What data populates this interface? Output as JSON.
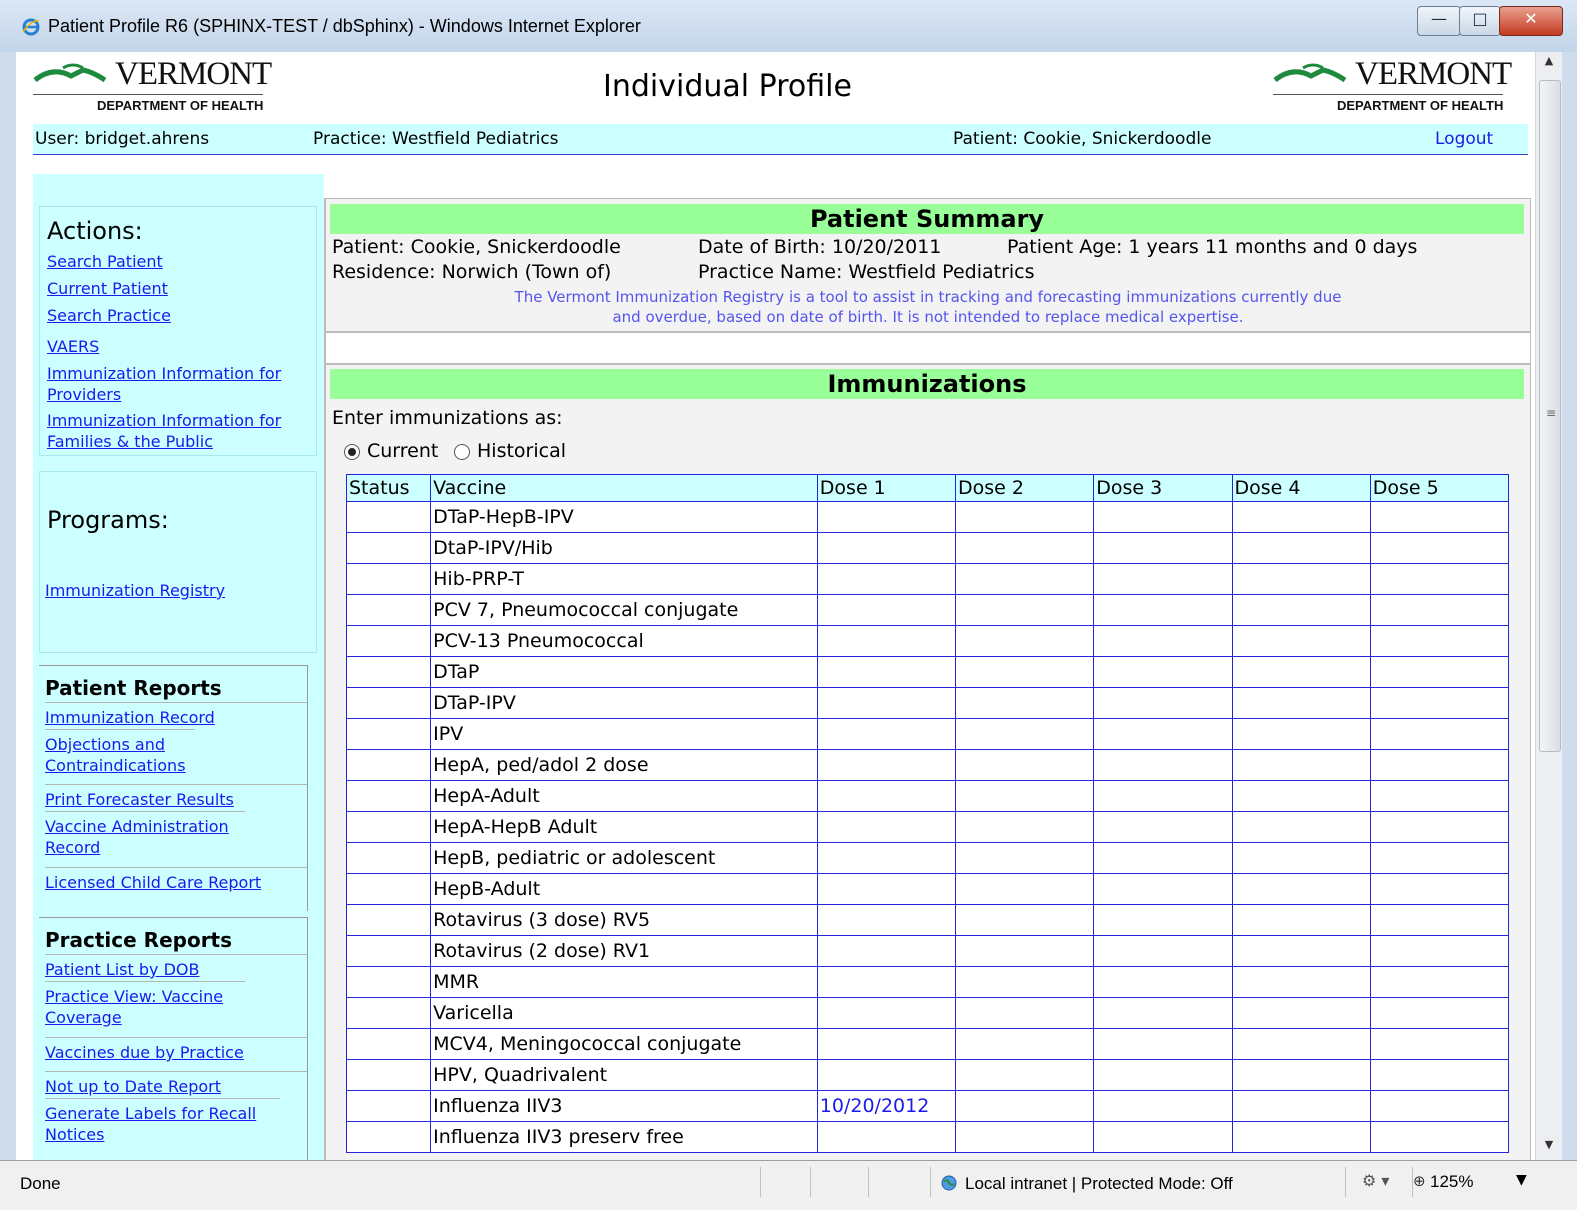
{
  "window": {
    "title": "Patient Profile R6 (SPHINX-TEST / dbSphinx) - Windows Internet Explorer",
    "minimize_icon": "minimize-icon",
    "maximize_icon": "maximize-icon",
    "close_icon": "close-icon"
  },
  "header": {
    "logo_left": {
      "word": "VERMONT",
      "dept": "DEPARTMENT OF HEALTH"
    },
    "title": "Individual Profile",
    "logo_right": {
      "word": "VERMONT",
      "dept": "DEPARTMENT OF HEALTH"
    }
  },
  "userbar": {
    "user": "User: bridget.ahrens",
    "practice": "Practice: Westfield Pediatrics",
    "patient": "Patient: Cookie, Snickerdoodle",
    "logout": "Logout"
  },
  "sidebar": {
    "actions_heading": "Actions:",
    "actions": [
      "Search Patient",
      "Current Patient",
      "Search Practice",
      "VAERS",
      "Immunization Information for Providers",
      "Immunization Information for Families & the Public"
    ],
    "programs_heading": "Programs:",
    "programs": [
      "Immunization Registry"
    ],
    "patient_reports_title": "Patient Reports",
    "patient_reports": [
      "Immunization Record",
      "Objections and Contraindications",
      "Print Forecaster Results",
      "Vaccine Administration Record",
      "Licensed Child Care Report"
    ],
    "practice_reports_title": "Practice Reports",
    "practice_reports": [
      "Patient List by DOB",
      "Practice View: Vaccine Coverage",
      "Vaccines due by Practice",
      "Not up to Date Report",
      "Generate Labels for Recall Notices"
    ]
  },
  "summary": {
    "heading": "Patient Summary",
    "patient": "Patient: Cookie, Snickerdoodle",
    "dob": "Date of Birth: 10/20/2011",
    "age": "Patient Age: 1 years 11 months and 0 days",
    "residence": "Residence: Norwich (Town of)",
    "practice_name": "Practice Name: Westfield Pediatrics",
    "disclaimer_line1": "The Vermont Immunization Registry is a tool to assist in tracking and forecasting immunizations currently due",
    "disclaimer_line2": "and overdue, based on date of birth. It is not intended to replace medical expertise."
  },
  "immunizations": {
    "heading": "Immunizations",
    "enter_label": "Enter immunizations as:",
    "mode_options": [
      "Current",
      "Historical"
    ],
    "selected_mode": "Current",
    "columns": [
      "Status",
      "Vaccine",
      "Dose 1",
      "Dose 2",
      "Dose 3",
      "Dose 4",
      "Dose 5"
    ],
    "rows": [
      {
        "vaccine": "DTaP-HepB-IPV",
        "doses": [
          "",
          "",
          "",
          "",
          ""
        ]
      },
      {
        "vaccine": "DtaP-IPV/Hib",
        "doses": [
          "",
          "",
          "",
          "",
          ""
        ]
      },
      {
        "vaccine": "Hib-PRP-T",
        "doses": [
          "",
          "",
          "",
          "",
          ""
        ]
      },
      {
        "vaccine": "PCV 7, Pneumococcal conjugate",
        "doses": [
          "",
          "",
          "",
          "",
          ""
        ]
      },
      {
        "vaccine": "PCV-13 Pneumococcal",
        "doses": [
          "",
          "",
          "",
          "",
          ""
        ]
      },
      {
        "vaccine": "DTaP",
        "doses": [
          "",
          "",
          "",
          "",
          ""
        ]
      },
      {
        "vaccine": "DTaP-IPV",
        "doses": [
          "",
          "",
          "",
          "",
          ""
        ]
      },
      {
        "vaccine": "IPV",
        "doses": [
          "",
          "",
          "",
          "",
          ""
        ]
      },
      {
        "vaccine": "HepA, ped/adol 2 dose",
        "doses": [
          "",
          "",
          "",
          "",
          ""
        ]
      },
      {
        "vaccine": "HepA-Adult",
        "doses": [
          "",
          "",
          "",
          "",
          ""
        ]
      },
      {
        "vaccine": "HepA-HepB Adult",
        "doses": [
          "",
          "",
          "",
          "",
          ""
        ]
      },
      {
        "vaccine": "HepB, pediatric or adolescent",
        "doses": [
          "",
          "",
          "",
          "",
          ""
        ]
      },
      {
        "vaccine": "HepB-Adult",
        "doses": [
          "",
          "",
          "",
          "",
          ""
        ]
      },
      {
        "vaccine": "Rotavirus (3 dose) RV5",
        "doses": [
          "",
          "",
          "",
          "",
          ""
        ]
      },
      {
        "vaccine": "Rotavirus (2 dose) RV1",
        "doses": [
          "",
          "",
          "",
          "",
          ""
        ]
      },
      {
        "vaccine": "MMR",
        "doses": [
          "",
          "",
          "",
          "",
          ""
        ]
      },
      {
        "vaccine": "Varicella",
        "doses": [
          "",
          "",
          "",
          "",
          ""
        ]
      },
      {
        "vaccine": "MCV4, Meningococcal conjugate",
        "doses": [
          "",
          "",
          "",
          "",
          ""
        ]
      },
      {
        "vaccine": "HPV, Quadrivalent",
        "doses": [
          "",
          "",
          "",
          "",
          ""
        ]
      },
      {
        "vaccine": "Influenza IIV3",
        "doses": [
          "10/20/2012",
          "",
          "",
          "",
          ""
        ]
      },
      {
        "vaccine": "Influenza IIV3 preserv free",
        "doses": [
          "",
          "",
          "",
          "",
          ""
        ]
      }
    ]
  },
  "statusbar": {
    "status": "Done",
    "zone": "Local intranet | Protected Mode: Off",
    "zoom": "125%"
  },
  "colors": {
    "summary_heading_bg": "#99ff99",
    "sidebar_bg": "#ccffff",
    "link": "#1a1aee",
    "table_border": "#2323e0"
  }
}
